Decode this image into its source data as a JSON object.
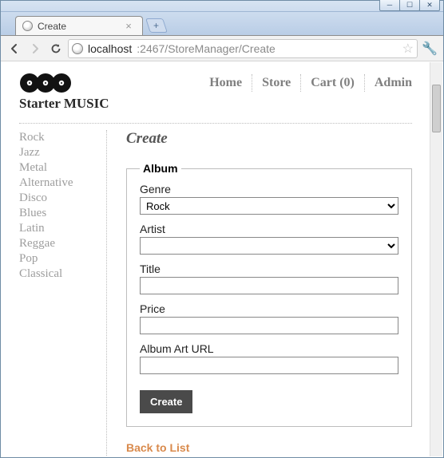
{
  "window": {
    "tab_title": "Create",
    "url_host": "localhost",
    "url_port_path": ":2467/StoreManager/Create"
  },
  "brand": "Starter MUSIC",
  "topnav": {
    "home": "Home",
    "store": "Store",
    "cart": "Cart (0)",
    "admin": "Admin"
  },
  "sidebar": {
    "items": [
      "Rock",
      "Jazz",
      "Metal",
      "Alternative",
      "Disco",
      "Blues",
      "Latin",
      "Reggae",
      "Pop",
      "Classical"
    ]
  },
  "page": {
    "title": "Create",
    "fieldset_legend": "Album",
    "labels": {
      "genre": "Genre",
      "artist": "Artist",
      "title": "Title",
      "price": "Price",
      "art_url": "Album Art URL"
    },
    "values": {
      "genre": "Rock",
      "artist": "",
      "title": "",
      "price": "",
      "art_url": ""
    },
    "submit_label": "Create",
    "back_label": "Back to List"
  }
}
